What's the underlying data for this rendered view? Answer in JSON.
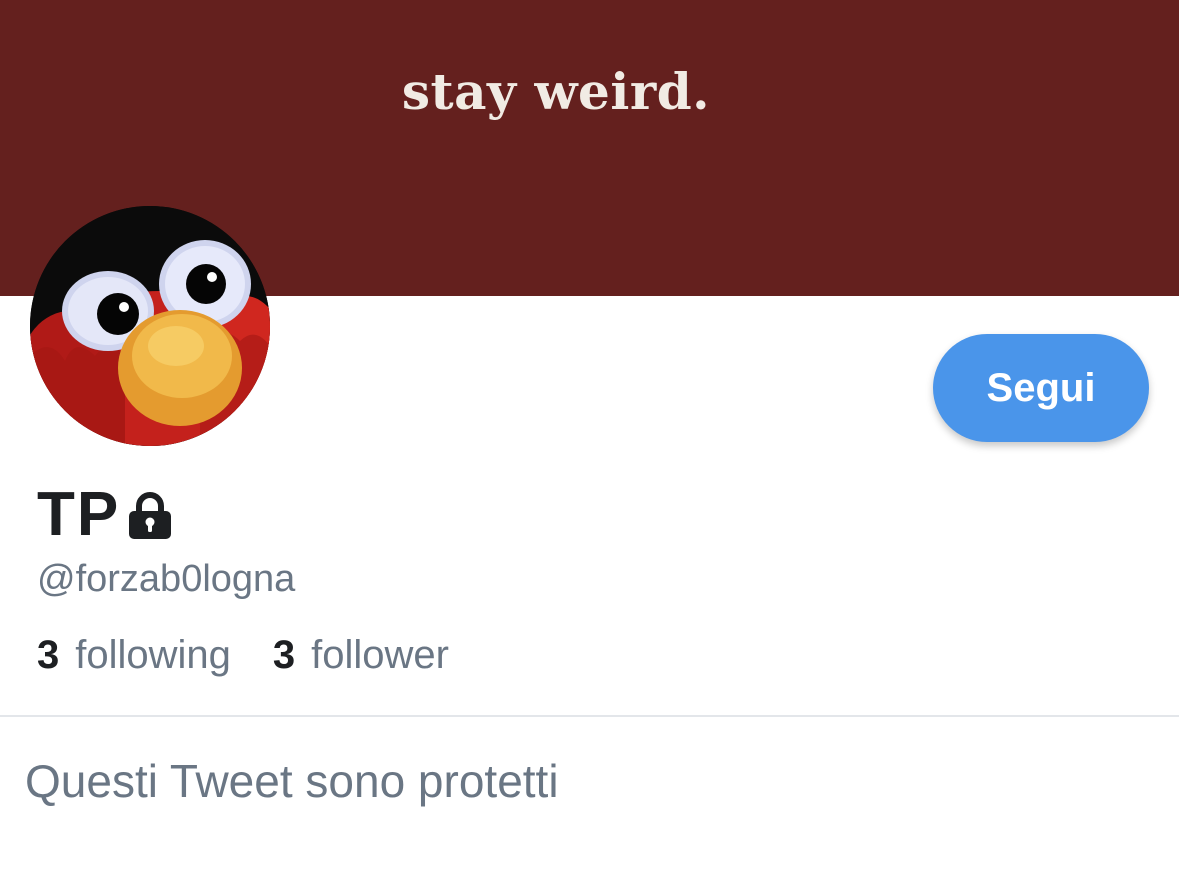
{
  "profile": {
    "banner": {
      "text": "stay weird.",
      "background_color": "#64201e"
    },
    "avatar": {
      "description_icon": "elmo-avatar"
    },
    "display_name": "TP",
    "protected_icon": "lock-icon",
    "handle": "@forzab0logna",
    "follow_button": {
      "label": "Segui",
      "color": "#4a95ea"
    },
    "stats": {
      "following_count": "3",
      "following_label": "following",
      "follower_count": "3",
      "follower_label": "follower"
    },
    "protected_message": "Questi Tweet sono protetti"
  }
}
